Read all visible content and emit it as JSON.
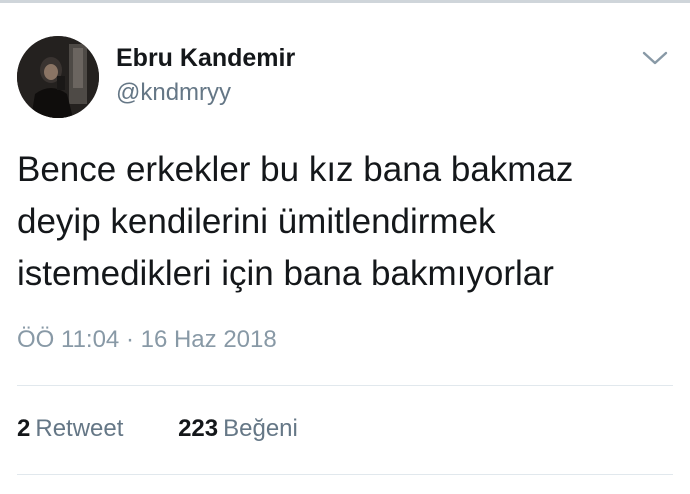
{
  "tweet": {
    "author": {
      "display_name": "Ebru Kandemir",
      "handle": "@kndmryy"
    },
    "text_lines": [
      "Bence erkekler bu kız bana bakmaz",
      "deyip kendilerini ümitlendirmek",
      "istemedikleri için bana bakmıyorlar"
    ],
    "timestamp": "ÖÖ 11:04 · 16 Haz 2018",
    "stats": {
      "retweets_count": "2",
      "retweets_label": "Retweet",
      "likes_count": "223",
      "likes_label": "Beğeni"
    },
    "icons": {
      "menu": "chevron-down-icon",
      "avatar": "profile-photo"
    }
  },
  "colors": {
    "text_primary": "#14171a",
    "text_secondary": "#657786",
    "timestamp": "#8899a6",
    "divider": "#e1e8ed"
  }
}
